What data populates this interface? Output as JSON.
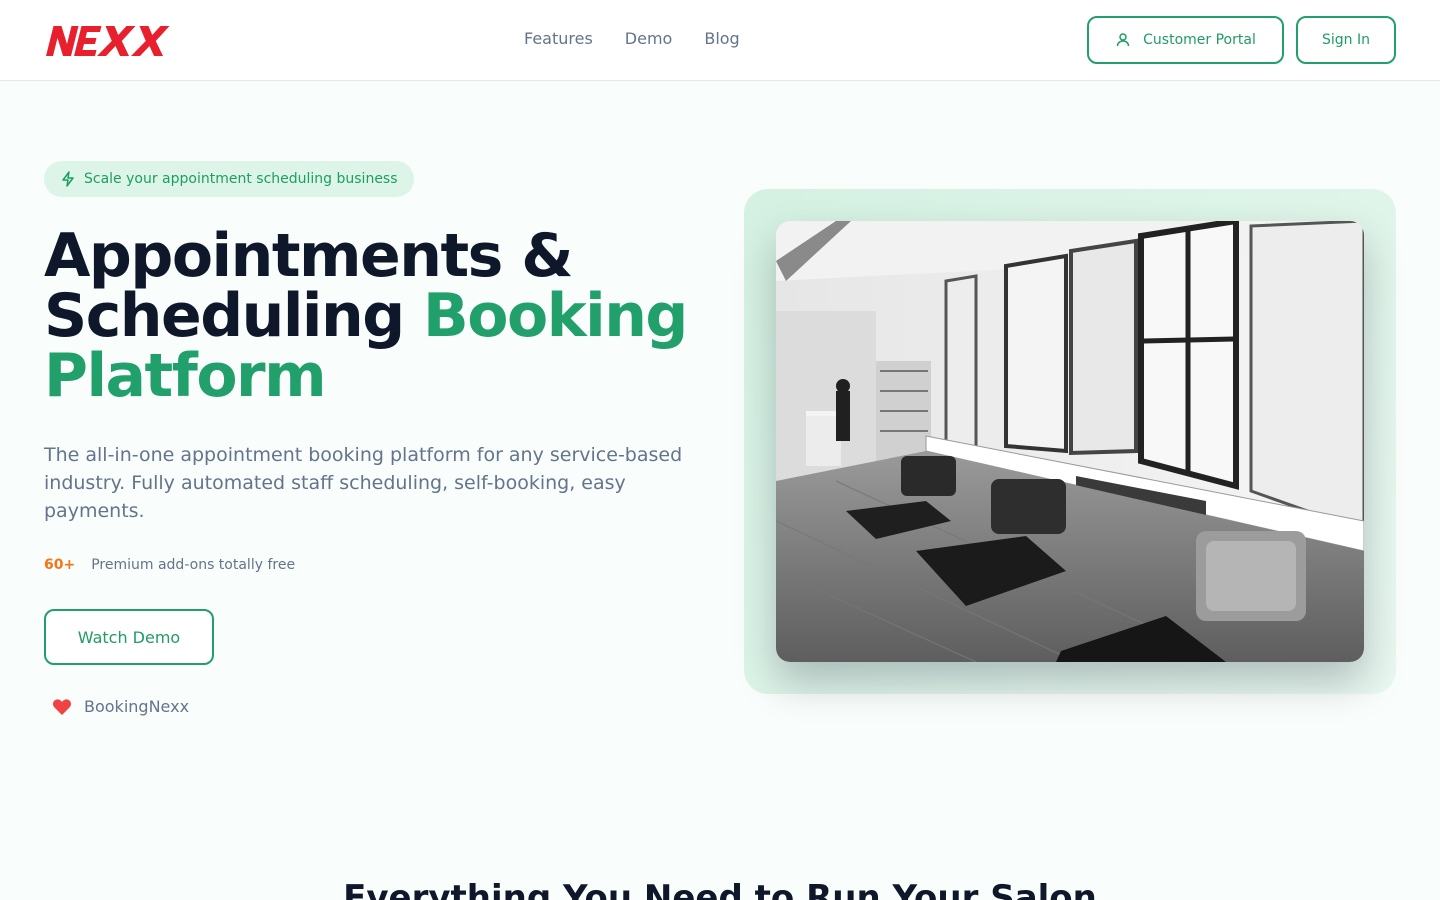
{
  "brand": {
    "logo_text": "NEXX",
    "name": "BookingNexx",
    "accent": "#22a06b",
    "logo_color": "#e8202e"
  },
  "nav": {
    "items": [
      "Features",
      "Demo",
      "Blog"
    ]
  },
  "header": {
    "portal_label": "Customer Portal",
    "signin_label": "Sign In"
  },
  "hero": {
    "pill_text": "Scale your appointment scheduling business",
    "title_line1": "Appointments &",
    "title_line2_part": "Scheduling ",
    "title_accent1": "Booking",
    "title_accent2": "Platform",
    "description": "The all-in-one appointment booking platform for any service-based industry. Fully automated staff scheduling, self-booking, easy payments.",
    "addons_count": "60+",
    "addons_text": "Premium add-ons totally free",
    "demo_button": "Watch Demo",
    "brand_credit": "BookingNexx"
  },
  "section": {
    "title": "Everything You Need to Run Your Salon"
  },
  "icons": {
    "pill_icon": "lightning-icon",
    "portal_icon": "user-icon",
    "credit_icon": "heart-icon"
  }
}
